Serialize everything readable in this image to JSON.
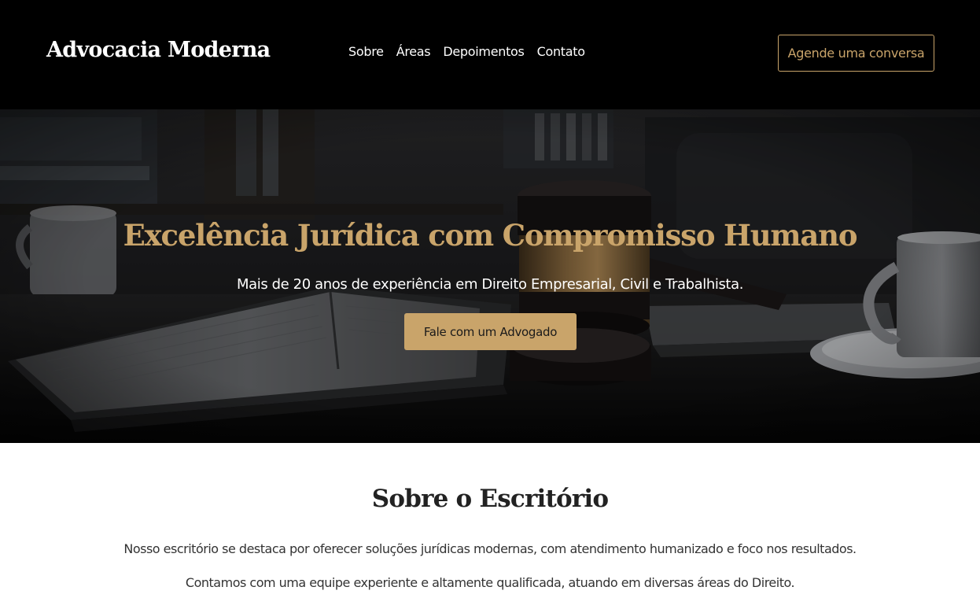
{
  "header": {
    "logo": "Advocacia Moderna",
    "nav": [
      "Sobre",
      "Áreas",
      "Depoimentos",
      "Contato"
    ],
    "cta_label": "Agende uma conversa"
  },
  "hero": {
    "title": "Excelência Jurídica com Compromisso Humano",
    "subtitle": "Mais de 20 anos de experiência em Direito Empresarial, Civil e Trabalhista.",
    "cta_label": "Fale com um Advogado",
    "background_image": "gavel-on-desk-with-books-and-coffee-cup"
  },
  "about": {
    "title": "Sobre o Escritório",
    "paragraphs": [
      "Nosso escritório se destaca por oferecer soluções jurídicas modernas, com atendimento humanizado e foco nos resultados.",
      "Contamos com uma equipe experiente e altamente qualificada, atuando em diversas áreas do Direito."
    ]
  },
  "colors": {
    "accent": "#c9a46a",
    "header_bg": "#000000",
    "heading_dark": "#222222",
    "body_text": "#333333"
  }
}
